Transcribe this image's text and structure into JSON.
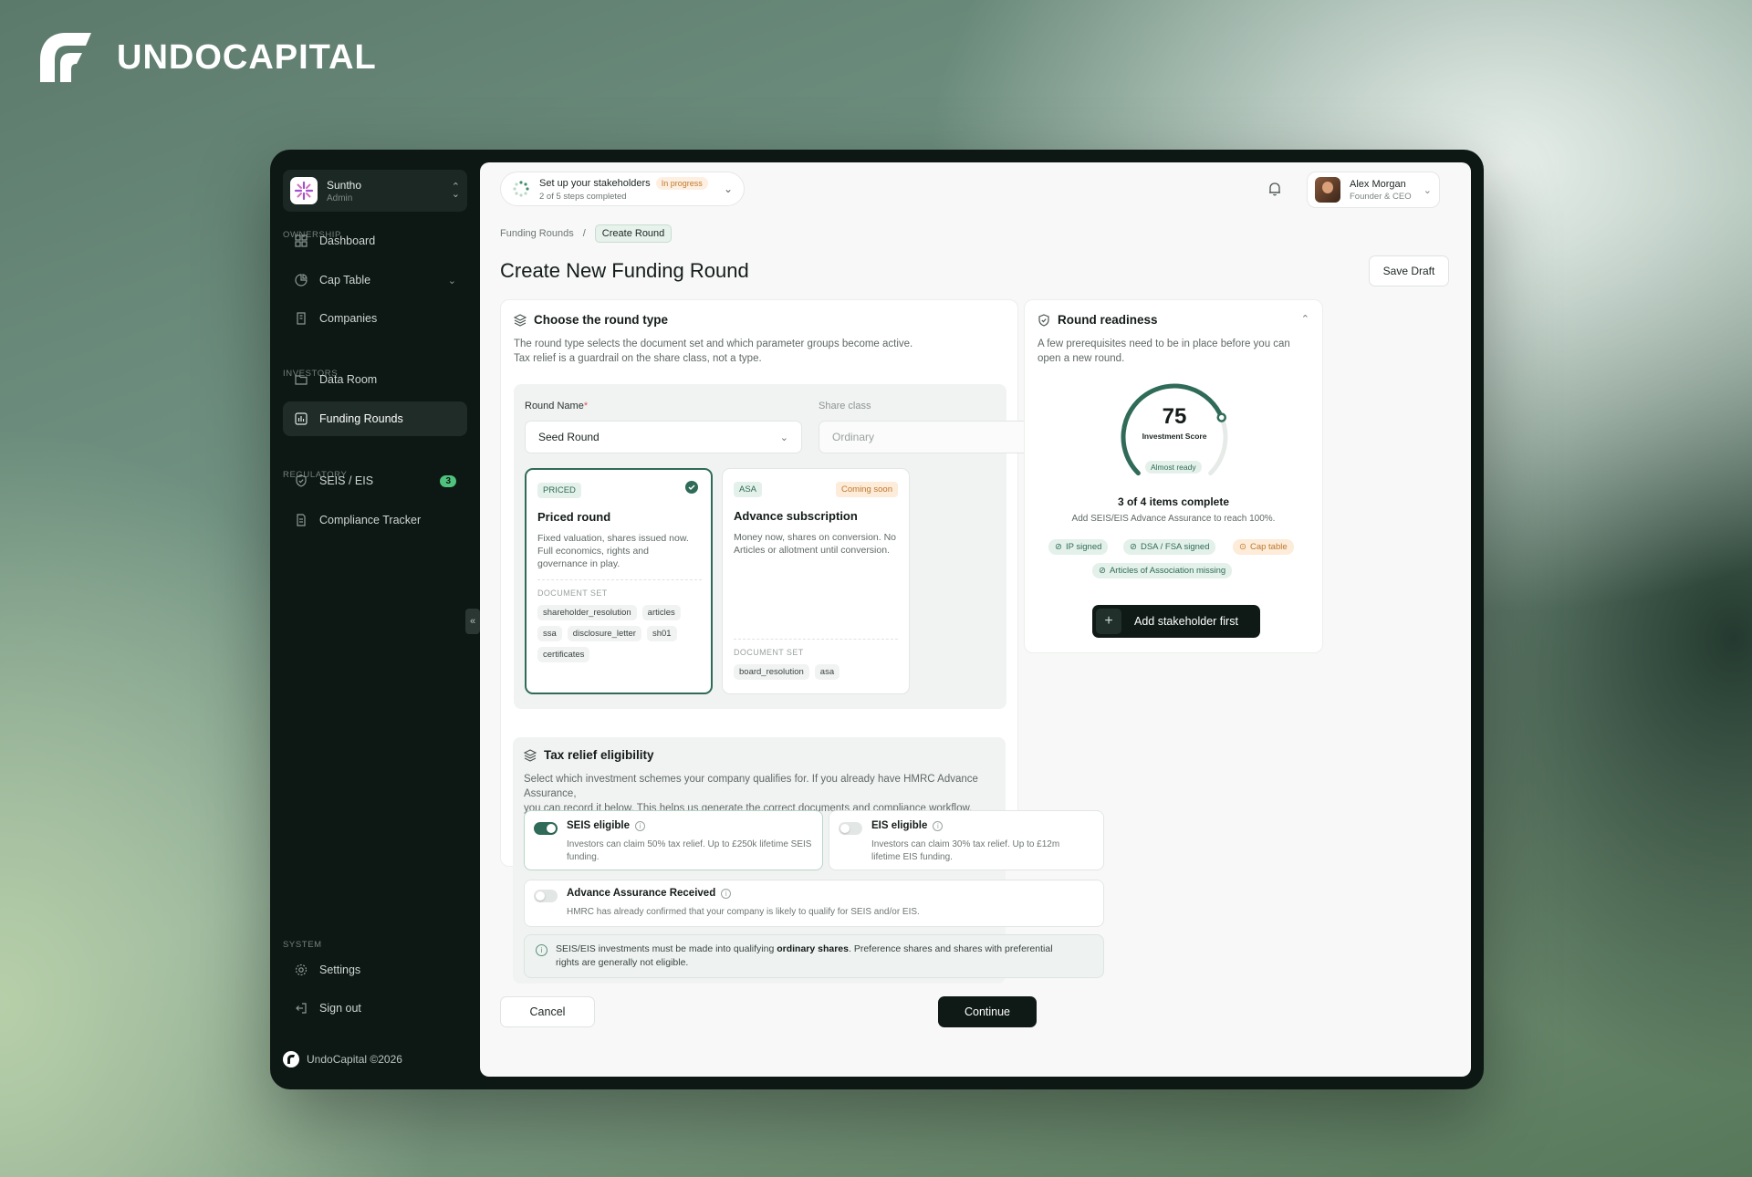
{
  "brand": {
    "name": "UNDOCAPITAL"
  },
  "sidebar": {
    "org": {
      "name": "Suntho",
      "role": "Admin"
    },
    "sections": {
      "ownership": "OWNERSHIP",
      "investors": "INVESTORS",
      "regulatory": "REGULATORY",
      "system": "SYSTEM"
    },
    "items": {
      "dashboard": "Dashboard",
      "cap_table": "Cap Table",
      "companies": "Companies",
      "data_room": "Data Room",
      "funding_rounds": "Funding Rounds",
      "seis_eis": "SEIS / EIS",
      "seis_eis_badge": "3",
      "compliance": "Compliance Tracker",
      "settings": "Settings",
      "sign_out": "Sign out"
    },
    "footer": "UndoCapital ©2026"
  },
  "topbar": {
    "task_title": "Set up your stakeholders",
    "task_status": "In progress",
    "task_sub": "2 of 5 steps completed",
    "user_name": "Alex Morgan",
    "user_role": "Founder & CEO"
  },
  "breadcrumb": {
    "parent": "Funding Rounds",
    "separator": "/",
    "current": "Create Round"
  },
  "page": {
    "title": "Create New Funding Round",
    "save_draft": "Save Draft"
  },
  "round_type": {
    "title": "Choose the round type",
    "desc1": "The round type selects the document set and which parameter groups become active.",
    "desc2": "Tax relief is a guardrail on the share class, not a type.",
    "round_name_label": "Round Name",
    "round_name_required": "*",
    "round_name_value": "Seed Round",
    "share_class_label": "Share class",
    "share_class_value": "Ordinary",
    "priced": {
      "tag": "PRICED",
      "title": "Priced round",
      "desc": "Fixed valuation, shares issued now. Full economics, rights and governance in play.",
      "doc_label": "DOCUMENT SET",
      "docs": [
        "shareholder_resolution",
        "articles",
        "ssa",
        "disclosure_letter",
        "sh01",
        "certificates"
      ]
    },
    "asa": {
      "tag": "ASA",
      "badge": "Coming soon",
      "title": "Advance subscription",
      "desc": "Money now, shares on conversion. No Articles or allotment until conversion.",
      "doc_label": "DOCUMENT SET",
      "docs": [
        "board_resolution",
        "asa"
      ]
    }
  },
  "tax": {
    "title": "Tax relief eligibility",
    "desc1": "Select which investment schemes your company qualifies for. If you already have HMRC Advance Assurance,",
    "desc2": "you can record it below. This helps us generate the correct documents and compliance workflow.",
    "seis_title": "SEIS eligible",
    "seis_desc": "Investors can claim 50% tax relief. Up to £250k lifetime SEIS funding.",
    "eis_title": "EIS eligible",
    "eis_desc": "Investors can claim 30% tax relief. Up to £12m lifetime EIS funding.",
    "aa_title": "Advance Assurance Received",
    "aa_desc": "HMRC has already confirmed that your company is likely to qualify for SEIS and/or EIS.",
    "notice_pre": "SEIS/EIS investments must be made into qualifying ",
    "notice_bold": "ordinary shares",
    "notice_post": ". Preference shares and shares with preferential",
    "notice_line2": "rights are generally not eligible."
  },
  "readiness": {
    "title": "Round readiness",
    "desc": "A few prerequisites need to be in place before you can open a new round.",
    "score": "75",
    "score_value": 0.75,
    "score_label": "Investment Score",
    "score_status": "Almost ready",
    "complete": "3 of 4 items complete",
    "complete_sub": "Add SEIS/EIS Advance Assurance to reach 100%.",
    "chips": {
      "ip": "IP signed",
      "dsa": "DSA / FSA signed",
      "cap": "Cap table",
      "articles": "Articles of Association missing"
    },
    "cta": "Add stakeholder first"
  },
  "actions": {
    "cancel": "Cancel",
    "continue": "Continue"
  },
  "colors": {
    "accent": "#2f6b58",
    "dark": "#0d1714",
    "warn": "#c0782e"
  }
}
